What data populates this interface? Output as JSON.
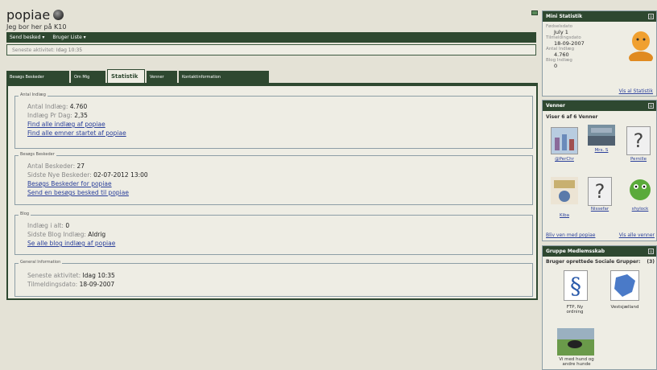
{
  "header": {
    "title": "popiae",
    "subtitle": "Jeg bor her på K10"
  },
  "menu": {
    "send_label": "Send besked ▾",
    "users_label": "Bruger Liste ▾"
  },
  "activity": {
    "label": "Seneste aktivitet:",
    "value": "Idag 10:35"
  },
  "tabs": [
    "Besøgs Beskeder",
    "Om Mig",
    "Statistik",
    "Venner",
    "Kontaktinformation"
  ],
  "stats": {
    "posts": {
      "legend": "Antal Indlæg",
      "count_label": "Antal Indlæg:",
      "count": "4.760",
      "per_day_label": "Indlæg Pr Dag:",
      "per_day": "2,35",
      "link1": "Find alle indlæg af popiae",
      "link2": "Find alle emner startet af popiae"
    },
    "visitor": {
      "legend": "Besøgs Beskeder",
      "count_label": "Antal Beskeder:",
      "count": "27",
      "newest_label": "Sidste Nye Beskeder:",
      "newest": "02-07-2012 13:00",
      "link1": "Besøgs Beskeder for popiae",
      "link2": "Send en besøgs besked til popiae"
    },
    "blog": {
      "legend": "Blog",
      "count_label": "Indlæg i alt:",
      "count": "0",
      "last_label": "Sidste Blog Indlæg:",
      "last": "Aldrig",
      "link1": "Se alle blog indlæg af popiae"
    },
    "general": {
      "legend": "General Information",
      "activity_label": "Seneste aktivitet:",
      "activity": "Idag 10:35",
      "joined_label": "Tilmeldingsdato:",
      "joined": "18-09-2007"
    }
  },
  "mini": {
    "title": "Mini Statistik",
    "birth_label": "Fødselsdato",
    "birth": "July 1",
    "joined_label": "Tilmeldingsdato",
    "joined": "18-09-2007",
    "posts_label": "Antal Indlæg",
    "posts": "4.760",
    "blog_label": "Blog Indlæg",
    "blog": "0",
    "link": "Vis al Statistik"
  },
  "friends": {
    "title": "Venner",
    "summary": "Viser 6 af 6 Venner",
    "names": [
      "@PerChr",
      "Mrs. S",
      "Pernille",
      "Kiba",
      "Nissefar",
      "shylock"
    ],
    "link_left": "Bliv ven med popiae",
    "link_right": "Vis alle venner"
  },
  "groups": {
    "title": "Gruppe Medlemsskab",
    "summary": "Bruger oprettede Sociale Grupper:",
    "count": "(3)",
    "names": [
      "FTP, Ny ordning",
      "Vestsjælland",
      "Vi med hund og andre hunde"
    ]
  }
}
